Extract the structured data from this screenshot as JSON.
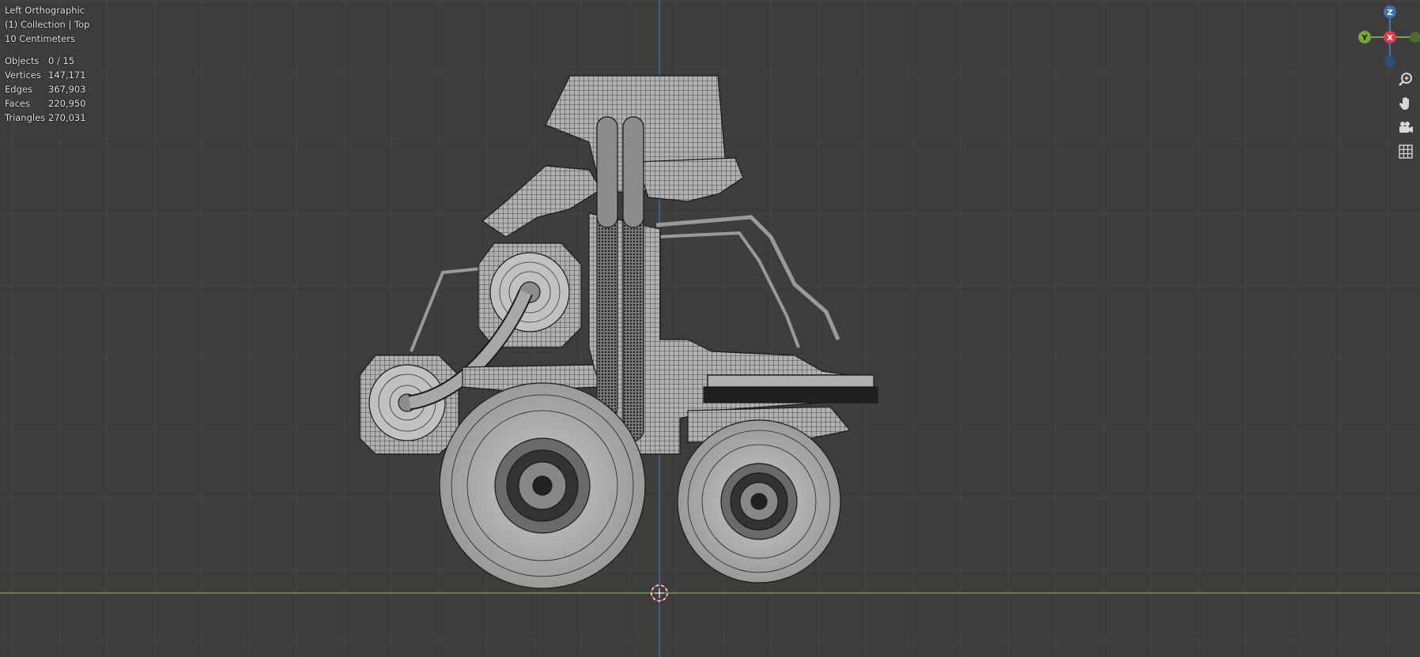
{
  "viewport": {
    "view_name": "Left Orthographic",
    "collection_line": "(1) Collection | Top",
    "grid_scale": "10 Centimeters"
  },
  "stats": [
    {
      "label": "Objects",
      "value": "0 / 15"
    },
    {
      "label": "Vertices",
      "value": "147,171"
    },
    {
      "label": "Edges",
      "value": "367,903"
    },
    {
      "label": "Faces",
      "value": "220,950"
    },
    {
      "label": "Triangles",
      "value": "270,031"
    }
  ],
  "gizmo": {
    "z": "Z",
    "y": "Y",
    "x": "X"
  },
  "colors": {
    "background": "#3d3d3d",
    "grid_minor": "#444444",
    "grid_major": "#555555",
    "axis_y": "#7aa83a",
    "axis_z": "#3f74b0",
    "mesh": "#a7a7a7",
    "wire": "#1a1a1a"
  },
  "nav_icons": [
    "zoom-icon",
    "pan-hand-icon",
    "camera-icon",
    "grid-icon"
  ]
}
